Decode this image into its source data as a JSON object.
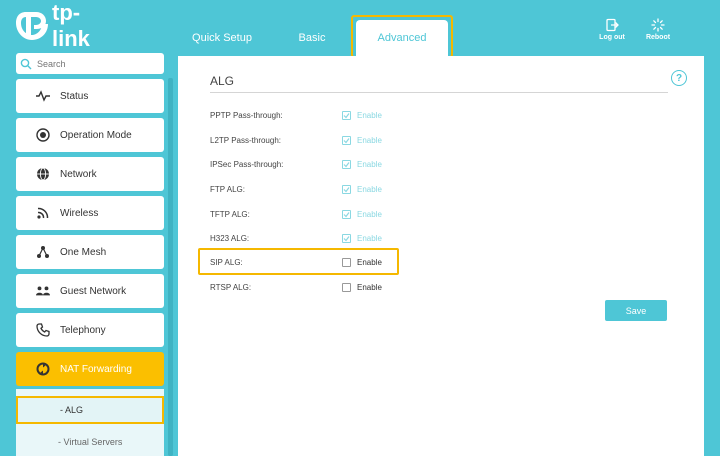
{
  "brand": {
    "name": "tp-link",
    "accent": "#4ec6d6",
    "highlight": "#f5b800"
  },
  "header": {
    "tabs": [
      {
        "label": "Quick Setup"
      },
      {
        "label": "Basic"
      },
      {
        "label": "Advanced",
        "selected": true
      }
    ],
    "logout_label": "Log out",
    "reboot_label": "Reboot"
  },
  "sidebar": {
    "search_placeholder": "Search",
    "items": [
      {
        "label": "Status",
        "icon": "pulse-icon"
      },
      {
        "label": "Operation Mode",
        "icon": "toggle-icon"
      },
      {
        "label": "Network",
        "icon": "globe-icon"
      },
      {
        "label": "Wireless",
        "icon": "wifi-icon"
      },
      {
        "label": "One Mesh",
        "icon": "mesh-icon"
      },
      {
        "label": "Guest Network",
        "icon": "guests-icon"
      },
      {
        "label": "Telephony",
        "icon": "phone-icon"
      },
      {
        "label": "NAT Forwarding",
        "icon": "nat-icon",
        "active": true
      }
    ],
    "subitems": [
      {
        "label": "- ALG",
        "selected": true
      },
      {
        "label": "- Virtual Servers"
      }
    ]
  },
  "main": {
    "section_title": "ALG",
    "rows": [
      {
        "label": "PPTP Pass-through:",
        "checked": true,
        "option": "Enable"
      },
      {
        "label": "L2TP Pass-through:",
        "checked": true,
        "option": "Enable"
      },
      {
        "label": "IPSec Pass-through:",
        "checked": true,
        "option": "Enable"
      },
      {
        "label": "FTP ALG:",
        "checked": true,
        "option": "Enable"
      },
      {
        "label": "TFTP ALG:",
        "checked": true,
        "option": "Enable"
      },
      {
        "label": "H323 ALG:",
        "checked": true,
        "option": "Enable"
      },
      {
        "label": "SIP ALG:",
        "checked": false,
        "option": "Enable"
      },
      {
        "label": "RTSP ALG:",
        "checked": false,
        "option": "Enable"
      }
    ],
    "save_label": "Save",
    "help_glyph": "?"
  }
}
